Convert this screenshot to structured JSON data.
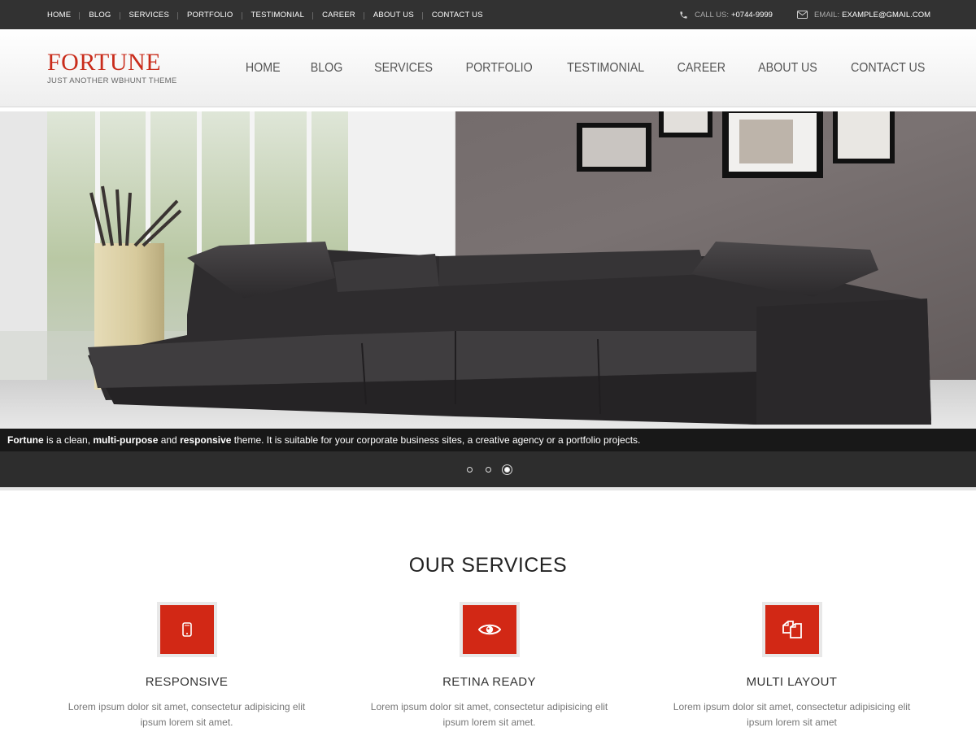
{
  "topbar": {
    "nav": [
      "HOME",
      "BLOG",
      "SERVICES",
      "PORTFOLIO",
      "TESTIMONIAL",
      "CAREER",
      "ABOUT US",
      "CONTACT US"
    ],
    "call_label": "CALL US:",
    "call_value": "+0744-9999",
    "email_label": "EMAIL:",
    "email_value": "EXAMPLE@GMAIL.COM"
  },
  "header": {
    "logo": "FORTUNE",
    "tagline": "JUST ANOTHER WBHUNT THEME",
    "nav": [
      "HOME",
      "BLOG",
      "SERVICES",
      "PORTFOLIO",
      "TESTIMONIAL",
      "CAREER",
      "ABOUT US",
      "CONTACT US"
    ]
  },
  "hero": {
    "caption_brand": "Fortune",
    "caption_mid1": " is a clean, ",
    "caption_bold": "multi-purpose",
    "caption_mid2": " and ",
    "caption_bold2": "responsive",
    "caption_rest": " theme. It is suitable for your corporate business sites, a creative agency or a portfolio projects.",
    "slides": 3,
    "active_slide": 3
  },
  "services": {
    "heading": "OUR SERVICES",
    "items": [
      {
        "icon": "mobile-icon",
        "title": "RESPONSIVE",
        "line1": "Lorem ipsum dolor sit amet, consectetur adipisicing elit",
        "line2": "ipsum lorem sit amet."
      },
      {
        "icon": "eye-icon",
        "title": "RETINA READY",
        "line1": "Lorem ipsum dolor sit amet, consectetur adipisicing elit",
        "line2": "ipsum lorem sit amet."
      },
      {
        "icon": "copy-icon",
        "title": "MULTI LAYOUT",
        "line1": "Lorem ipsum dolor sit amet, consectetur adipisicing elit",
        "line2": "ipsum lorem sit amet"
      }
    ]
  },
  "colors": {
    "accent": "#d22815",
    "logo": "#c92c1b",
    "topbar": "#323232"
  }
}
